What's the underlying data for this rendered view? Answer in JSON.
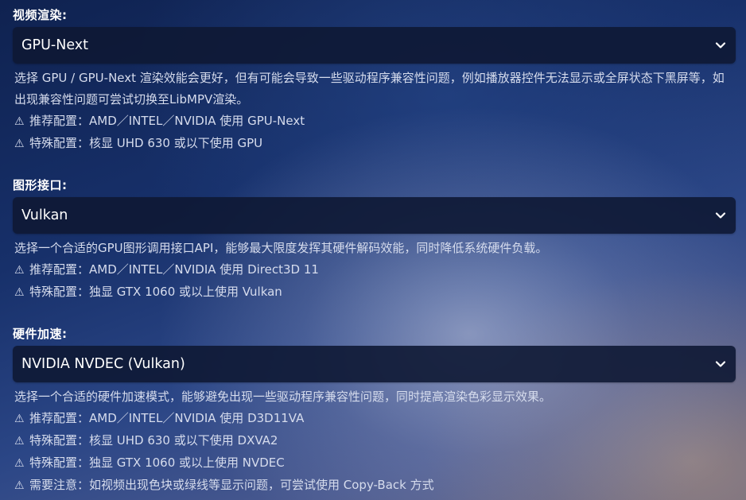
{
  "video_render": {
    "label": "视频渲染:",
    "value": "GPU-Next",
    "description": "选择 GPU / GPU-Next 渲染效能会更好，但有可能会导致一些驱动程序兼容性问题，例如播放器控件无法显示或全屏状态下黑屏等，如出现兼容性问题可尝试切换至LibMPV渲染。",
    "notes": [
      "推荐配置：AMD／INTEL／NVIDIA 使用 GPU-Next",
      "特殊配置：核显 UHD 630 或以下使用 GPU"
    ]
  },
  "graphics_api": {
    "label": "图形接口:",
    "value": "Vulkan",
    "description": "选择一个合适的GPU图形调用接口API，能够最大限度发挥其硬件解码效能，同时降低系统硬件负载。",
    "notes": [
      "推荐配置：AMD／INTEL／NVIDIA 使用 Direct3D 11",
      "特殊配置：独显 GTX 1060 或以上使用 Vulkan"
    ]
  },
  "hw_accel": {
    "label": "硬件加速:",
    "value": "NVIDIA NVDEC (Vulkan)",
    "description": "选择一个合适的硬件加速模式，能够避免出现一些驱动程序兼容性问题，同时提高渲染色彩显示效果。",
    "notes": [
      "推荐配置：AMD／INTEL／NVIDIA 使用 D3D11VA",
      "特殊配置：核显 UHD 630 或以下使用 DXVA2",
      "特殊配置：独显 GTX 1060 或以上使用 NVDEC",
      "需要注意：如视频出现色块或绿线等显示问题，可尝试使用 Copy-Back 方式"
    ]
  },
  "icons": {
    "warning": "⚠",
    "dropdown": "chevron-down-icon"
  },
  "colors": {
    "select_bg": "#0e1834",
    "text_primary": "#ffffff",
    "text_secondary": "#d6dced"
  }
}
